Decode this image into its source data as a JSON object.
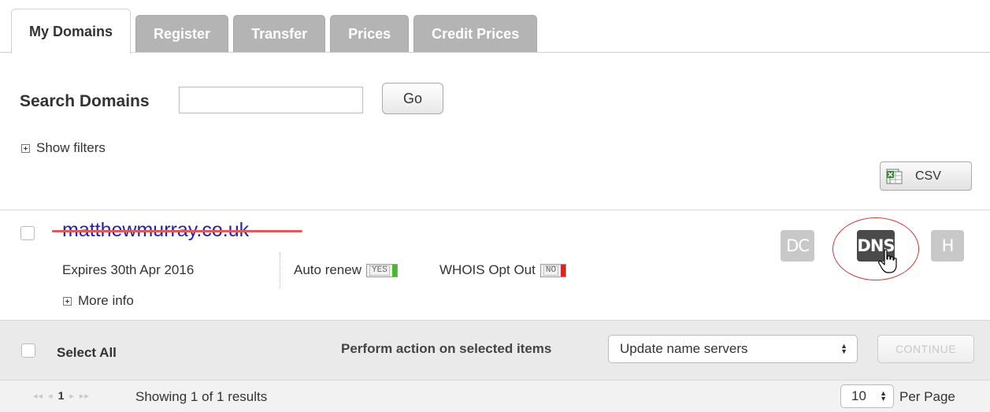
{
  "tabs": [
    {
      "label": "My Domains",
      "active": true
    },
    {
      "label": "Register",
      "active": false
    },
    {
      "label": "Transfer",
      "active": false
    },
    {
      "label": "Prices",
      "active": false
    },
    {
      "label": "Credit Prices",
      "active": false
    }
  ],
  "search": {
    "label": "Search Domains",
    "value": "",
    "go_label": "Go"
  },
  "filters": {
    "label": "Show filters"
  },
  "export": {
    "csv_label": "CSV"
  },
  "domain": {
    "name": "matthewmurray.co.uk",
    "expires": "Expires 30th Apr 2016",
    "auto_renew_label": "Auto renew",
    "auto_renew_value": "YES",
    "whois_label": "WHOIS Opt Out",
    "whois_value": "NO",
    "more_info": "More info",
    "buttons": {
      "dc": "DC",
      "dns": "DNS",
      "h": "H"
    }
  },
  "actions": {
    "select_all": "Select All",
    "perform_label": "Perform action on selected items",
    "selected_action": "Update name servers",
    "continue_label": "CONTINUE"
  },
  "pagination": {
    "first": "◂◂",
    "prev": "◂",
    "current_page": "1",
    "next": "▸",
    "last": "▸▸",
    "showing": "Showing 1 of 1 results",
    "per_page_value": "10",
    "per_page_label": "Per Page"
  },
  "colors": {
    "yes_indicator": "#44bb22",
    "no_indicator": "#dd2222",
    "link": "#2222bb",
    "strike": "#e05a5a"
  }
}
